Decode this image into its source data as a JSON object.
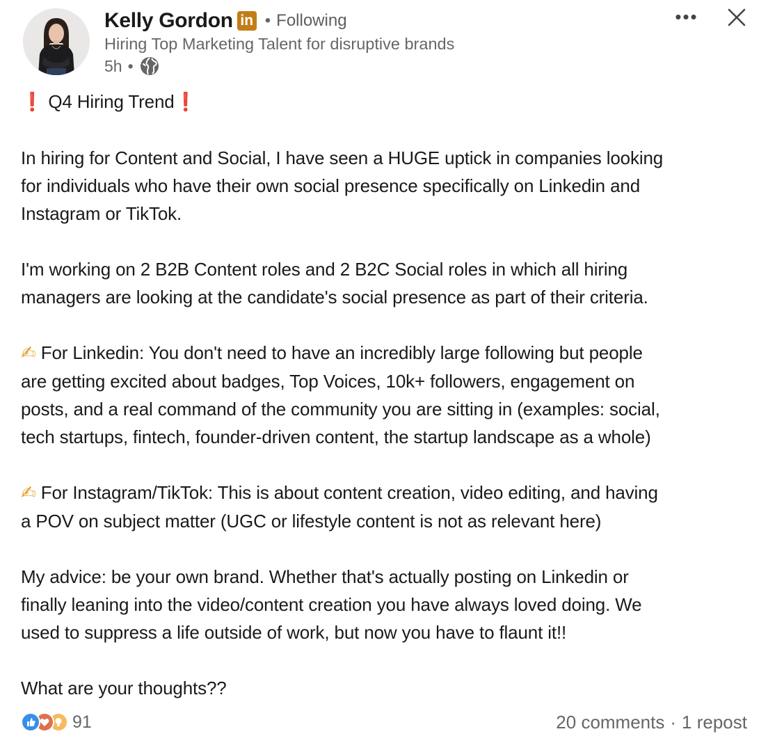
{
  "author": {
    "name": "Kelly Gordon",
    "badge": "in",
    "separator": "•",
    "follow_status": "Following",
    "headline": "Hiring Top Marketing Talent for disruptive brands",
    "time": "5h",
    "meta_separator": "•",
    "visibility_icon": "globe-icon"
  },
  "actions": {
    "more_label": "•••",
    "close_icon": "close-icon"
  },
  "post": {
    "title_emoji": "❗",
    "title": "Q4 Hiring Trend",
    "hand_emoji": "✍",
    "paragraph_1": "In hiring for Content and Social, I have seen a HUGE uptick in companies looking\nfor individuals who have their own social presence specifically on Linkedin and\nInstagram or TikTok.",
    "paragraph_2": "I'm working on 2 B2B Content roles and 2 B2C Social roles in which all hiring\nmanagers are looking at the candidate's social presence as part of their criteria.",
    "paragraph_3": "For Linkedin: You don't need to have an incredibly large following but people\nare getting excited about badges, Top Voices, 10k+ followers, engagement on\nposts, and a real command of the community you are sitting in (examples: social,\ntech startups, fintech, founder-driven content, the startup landscape as a whole)",
    "paragraph_4": "For Instagram/TikTok: This is about content creation, video editing, and having\na POV on subject matter (UGC or lifestyle content is not as relevant here)",
    "paragraph_5": "My advice: be your own brand. Whether that's actually posting on Linkedin or\nfinally leaning into the video/content creation you have always loved doing. We\nused to suppress a life outside of work, but now you have to flaunt it!!",
    "paragraph_6": "What are your thoughts??"
  },
  "footer": {
    "reaction_icons": [
      "like-icon",
      "love-icon",
      "insightful-icon"
    ],
    "reaction_count": "91",
    "comments": "20 comments",
    "separator": "·",
    "reposts": "1 repost"
  },
  "colors": {
    "badge": "#c37d16",
    "like": "#378fe9",
    "love": "#df704d",
    "insightful": "#f5bb5c",
    "alert": "#e0222a"
  }
}
